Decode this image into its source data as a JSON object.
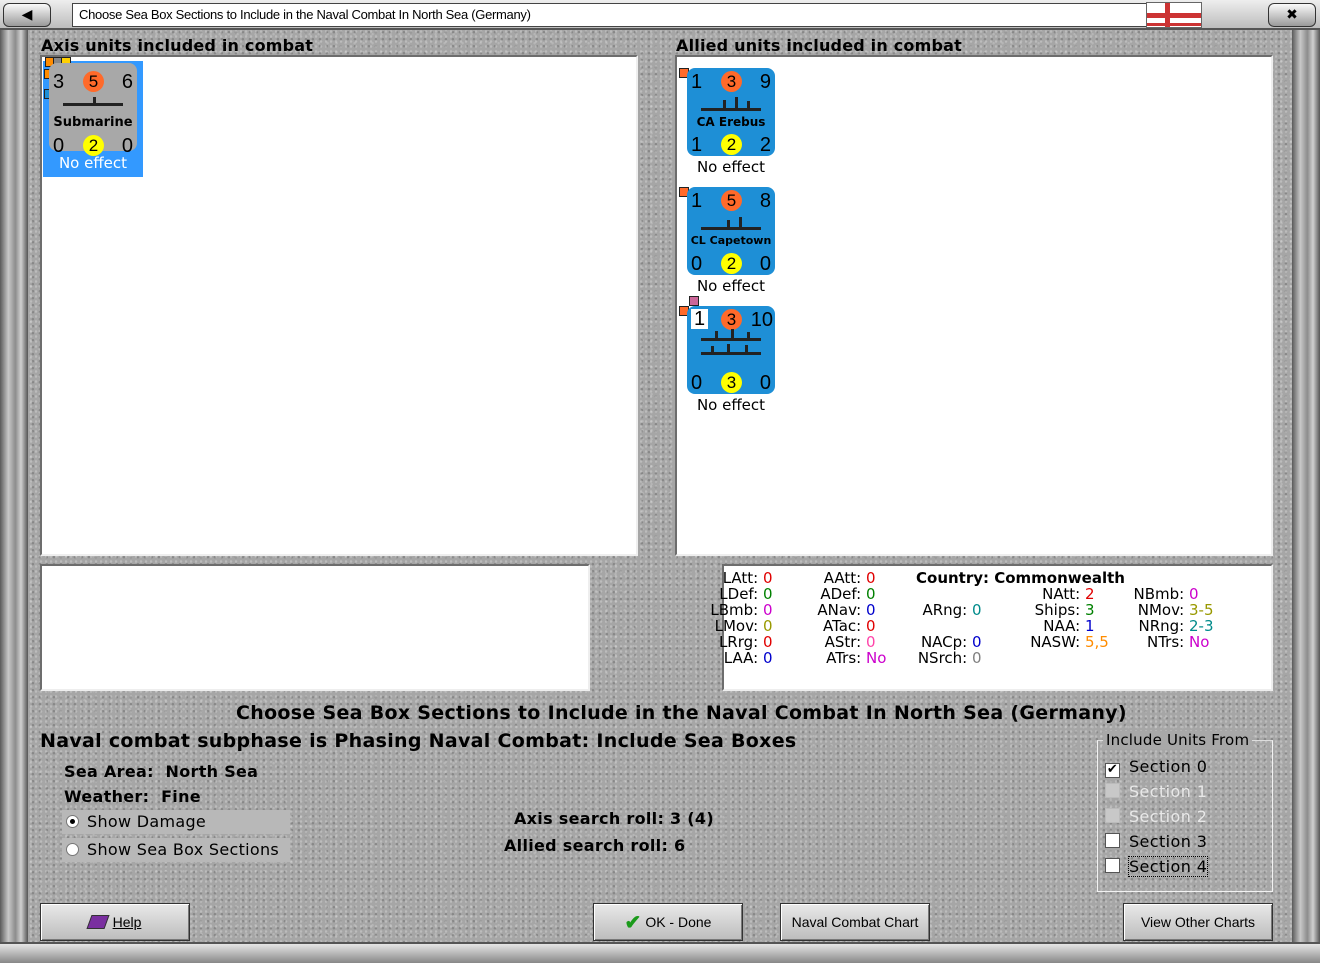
{
  "window": {
    "title": "Choose Sea Box Sections to Include in the Naval Combat In North Sea (Germany)"
  },
  "axis": {
    "title": "Axis units included in combat",
    "units": [
      {
        "name": "Submarine",
        "top_left": "3",
        "top_mid": "5",
        "top_right": "6",
        "bot_left": "0",
        "bot_mid": "2",
        "bot_right": "0",
        "result": "No effect",
        "selected": true
      }
    ]
  },
  "allied": {
    "title": "Allied units included in combat",
    "units": [
      {
        "name": "CA Erebus",
        "top_left": "1",
        "top_mid": "3",
        "top_right": "9",
        "bot_left": "1",
        "bot_mid": "2",
        "bot_right": "2",
        "result": "No effect"
      },
      {
        "name": "CL Capetown",
        "top_left": "1",
        "top_mid": "5",
        "top_right": "8",
        "bot_left": "0",
        "bot_mid": "2",
        "bot_right": "0",
        "result": "No effect"
      },
      {
        "name": "",
        "top_left": "1",
        "top_mid": "3",
        "top_right": "10",
        "bot_left": "0",
        "bot_mid": "3",
        "bot_right": "0",
        "result": "No effect"
      }
    ]
  },
  "stats": {
    "country": "Country: Commonwealth",
    "col1": [
      {
        "label": "LAtt:",
        "value": "0",
        "color": "#e00000"
      },
      {
        "label": "LDef:",
        "value": "0",
        "color": "#008000"
      },
      {
        "label": "LBmb:",
        "value": "0",
        "color": "#cc00cc"
      },
      {
        "label": "LMov:",
        "value": "0",
        "color": "#999900"
      },
      {
        "label": "LRrg:",
        "value": "0",
        "color": "#e00000"
      },
      {
        "label": "LAA:",
        "value": "0",
        "color": "#0000cc"
      }
    ],
    "col2": [
      {
        "label": "AAtt:",
        "value": "0",
        "color": "#e00000"
      },
      {
        "label": "ADef:",
        "value": "0",
        "color": "#008000"
      },
      {
        "label": "ANav:",
        "value": "0",
        "color": "#0000cc"
      },
      {
        "label": "ATac:",
        "value": "0",
        "color": "#e00000"
      },
      {
        "label": "AStr:",
        "value": "0",
        "color": "#ff44aa"
      },
      {
        "label": "ATrs:",
        "value": "No",
        "color": "#cc00cc"
      }
    ],
    "col3": [
      {
        "label": "ARng:",
        "value": "0",
        "color": "#008b8b"
      },
      {
        "label": "NACp:",
        "value": "0",
        "color": "#0000cc"
      },
      {
        "label": "NSrch:",
        "value": "0",
        "color": "#808080"
      }
    ],
    "col4": [
      {
        "label": "NAtt:",
        "value": "2",
        "color": "#e00000"
      },
      {
        "label": "Ships:",
        "value": "3",
        "color": "#008000"
      },
      {
        "label": "NAA:",
        "value": "1",
        "color": "#0000cc"
      },
      {
        "label": "NASW:",
        "value": "5,5",
        "color": "#ff8c00"
      }
    ],
    "col5": [
      {
        "label": "NBmb:",
        "value": "0",
        "color": "#cc00cc"
      },
      {
        "label": "NMov:",
        "value": "3-5",
        "color": "#999900"
      },
      {
        "label": "NRng:",
        "value": "2-3",
        "color": "#008b8b"
      },
      {
        "label": "NTrs:",
        "value": "No",
        "color": "#cc00cc"
      }
    ]
  },
  "main": {
    "heading": "Choose Sea Box Sections to Include in the Naval Combat In North Sea (Germany)",
    "subphase": "Naval combat subphase is Phasing Naval Combat: Include Sea Boxes",
    "sea_area_label": "Sea Area:",
    "sea_area": "North Sea",
    "weather_label": "Weather:",
    "weather": "Fine",
    "show_damage": "Show Damage",
    "show_sections": "Show Sea Box Sections",
    "axis_roll": "Axis search roll: 3 (4)",
    "allied_roll": "Allied search roll: 6"
  },
  "include_units": {
    "title": "Include Units From",
    "sections": [
      {
        "label": "Section 0",
        "checked": true,
        "enabled": true
      },
      {
        "label": "Section 1",
        "checked": false,
        "enabled": false
      },
      {
        "label": "Section 2",
        "checked": false,
        "enabled": false
      },
      {
        "label": "Section 3",
        "checked": false,
        "enabled": true
      },
      {
        "label": "Section 4",
        "checked": false,
        "enabled": true
      }
    ]
  },
  "buttons": {
    "help": "Help",
    "ok": "OK - Done",
    "chart": "Naval Combat Chart",
    "other": "View Other Charts"
  },
  "colors": {
    "counter_axis": "#a8a8a8",
    "counter_allied": "#1e8fd6",
    "circle_top": "#ff6a2a",
    "circle_bottom": "#ffff00",
    "selection": "#3399ff"
  }
}
